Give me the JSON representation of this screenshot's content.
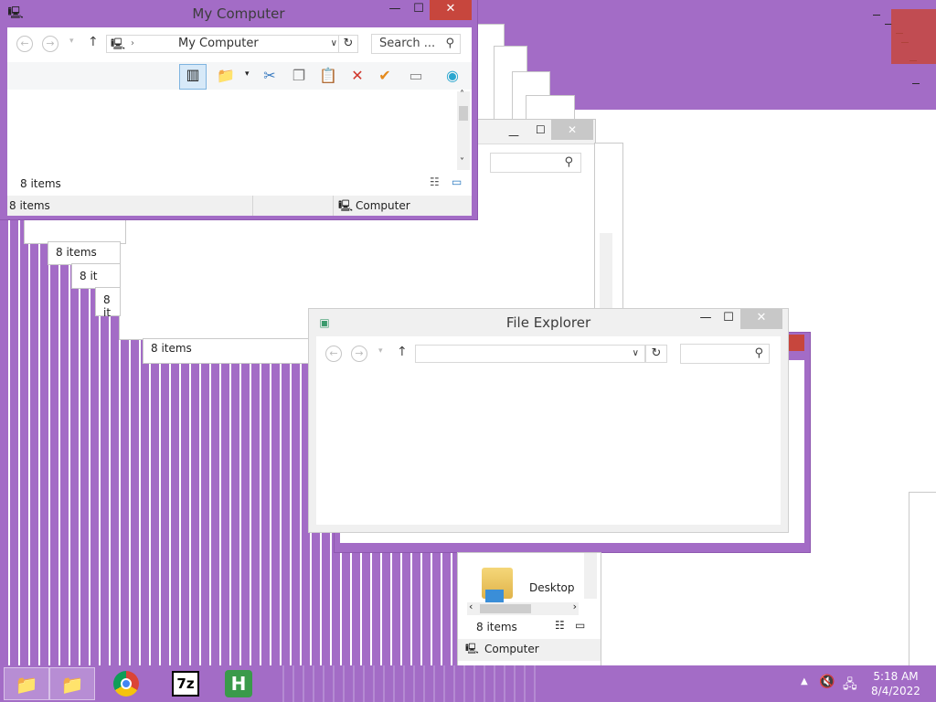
{
  "main_window": {
    "title": "My Computer",
    "address": "My Computer",
    "search_placeholder": "Search ...",
    "inner_status": "8 items",
    "status_left": "8 items",
    "status_right": "Computer"
  },
  "explorer_window": {
    "title": "File Explorer",
    "address": "",
    "search_placeholder": ""
  },
  "echo_windows": {
    "items_labels": [
      "8 items",
      "8 it",
      "8 it",
      "8 items",
      "8 items"
    ],
    "desktop_label": "Desktop",
    "computer_label": "Computer"
  },
  "taskbar": {
    "apps": [
      "file-explorer",
      "file-explorer",
      "chrome",
      "7-zip",
      "hex-editor"
    ],
    "sevenzip_label": "7z",
    "hex_label": "H",
    "clock_time": "5:18 AM",
    "clock_date": "8/4/2022"
  },
  "colors": {
    "accent": "#a36cc6",
    "close_red": "#c7463d"
  }
}
